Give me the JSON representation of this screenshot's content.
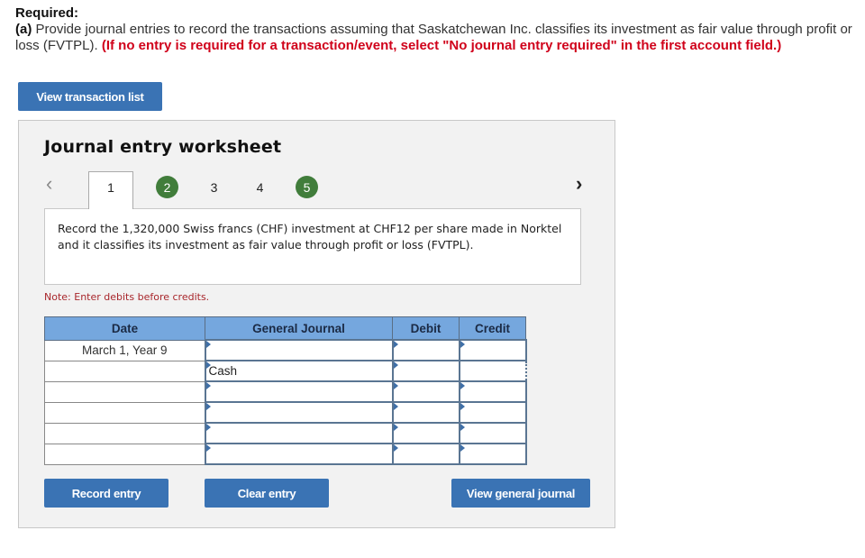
{
  "instructions": {
    "title": "Required:",
    "part_label": "(a)",
    "text": " Provide journal entries to record the transactions assuming that Saskatchewan Inc. classifies its investment as fair value through profit or loss (FVTPL). ",
    "red_note": "(If no entry is required for a transaction/event, select \"No journal entry required\" in the first account field.)"
  },
  "buttons": {
    "view_transaction_list": "View transaction list",
    "record_entry": "Record entry",
    "clear_entry": "Clear entry",
    "view_general_journal": "View general journal"
  },
  "worksheet": {
    "title": "Journal entry worksheet",
    "nav_prev": "<",
    "nav_next": ">",
    "tabs": [
      {
        "label": "1",
        "state": "active"
      },
      {
        "label": "2",
        "state": "completed"
      },
      {
        "label": "3",
        "state": "pending"
      },
      {
        "label": "4",
        "state": "pending"
      },
      {
        "label": "5",
        "state": "completed"
      }
    ],
    "description": "Record the 1,320,000 Swiss francs (CHF) investment at CHF12 per share made in Norktel and it classifies its investment as fair value through profit or loss (FVTPL).",
    "note": "Note: Enter debits before credits."
  },
  "table": {
    "headers": [
      "Date",
      "General Journal",
      "Debit",
      "Credit"
    ],
    "rows": [
      {
        "date": "March 1, Year 9",
        "account": "",
        "debit": "",
        "credit": ""
      },
      {
        "date": "",
        "account": "Cash",
        "debit": "",
        "credit": ""
      },
      {
        "date": "",
        "account": "",
        "debit": "",
        "credit": ""
      },
      {
        "date": "",
        "account": "",
        "debit": "",
        "credit": ""
      },
      {
        "date": "",
        "account": "",
        "debit": "",
        "credit": ""
      },
      {
        "date": "",
        "account": "",
        "debit": "",
        "credit": ""
      }
    ]
  },
  "colors": {
    "button_blue": "#3a73b4",
    "header_blue": "#75a7de",
    "completed_green": "#417d3b",
    "required_red": "#d0021b",
    "note_red": "#a8262b"
  }
}
